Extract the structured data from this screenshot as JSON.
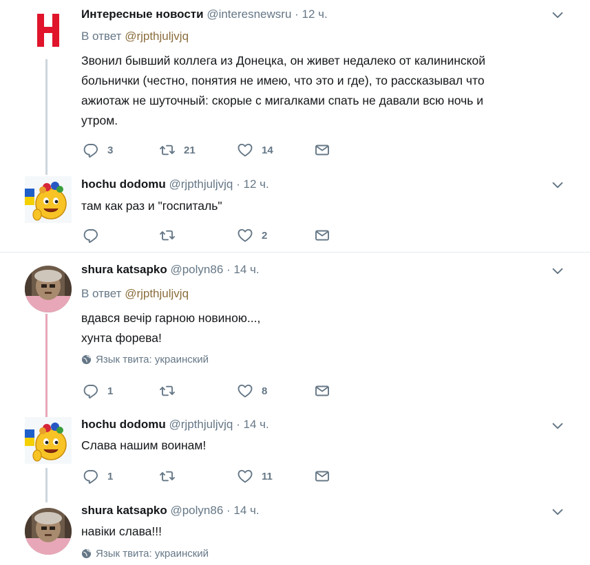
{
  "tweets": [
    {
      "name": "Интересные новости",
      "handle": "@interesnewsru",
      "dot": "·",
      "time": "12 ч.",
      "reply_prefix": "В ответ",
      "reply_to": "@rjpthjuljvjq",
      "text": "Звонил бывший коллега из Донецка, он живет недалеко от калининской\nбольнички (честно, понятия не имею, что это и где), то рассказывал что\nажиотаж не шуточный: скорые с мигалками спать не давали всю ночь и\nутром.",
      "replies": "3",
      "retweets": "21",
      "likes": "14"
    },
    {
      "name": "hochu dodomu",
      "handle": "@rjpthjuljvjq",
      "dot": "·",
      "time": "12 ч.",
      "text": "там как раз и \"госпиталь\"",
      "replies": "",
      "retweets": "",
      "likes": "2"
    },
    {
      "name": "shura katsapko",
      "handle": "@polyn86",
      "dot": "·",
      "time": "14 ч.",
      "reply_prefix": "В ответ",
      "reply_to": "@rjpthjuljvjq",
      "text": "вдався вечір гарною новиною...,\nхунта форева!",
      "lang": "Язык твита: украинский",
      "replies": "1",
      "retweets": "",
      "likes": "8"
    },
    {
      "name": "hochu dodomu",
      "handle": "@rjpthjuljvjq",
      "dot": "·",
      "time": "14 ч.",
      "text": "Слава нашим воинам!",
      "replies": "1",
      "retweets": "",
      "likes": "11"
    },
    {
      "name": "shura katsapko",
      "handle": "@polyn86",
      "dot": "·",
      "time": "14 ч.",
      "text": "навіки слава!!!",
      "lang": "Язык твита: украинский"
    }
  ],
  "icons": {
    "reply": "reply-icon",
    "retweet": "retweet-icon",
    "like": "like-icon",
    "dm": "direct-message-icon",
    "more": "chevron-down-icon",
    "globe": "globe-icon"
  },
  "colors": {
    "brand_red": "#e0142b",
    "secondary_text": "#657786",
    "mention": "#8a6d3b",
    "thread_line": "#ccd6dd"
  }
}
